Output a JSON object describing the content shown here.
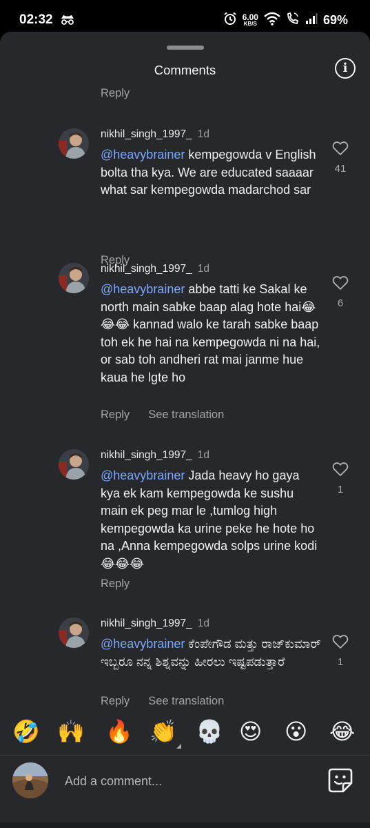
{
  "status_bar": {
    "time": "02:32",
    "net_speed_value": "6.00",
    "net_speed_unit": "KB/S",
    "battery": "69%"
  },
  "sheet": {
    "title": "Comments",
    "info_icon": "info-icon"
  },
  "reply_label_top": "Reply",
  "comments": [
    {
      "username": "nikhil_singh_1997_",
      "time": "1d",
      "mention": "@heavybrainer",
      "text": " kempegowda v English bolta tha kya. We are educated saaaar what sar kempegowda madarchod sar",
      "likes": "41",
      "reply": "Reply",
      "see_translation": ""
    },
    {
      "username": "nikhil_singh_1997_",
      "time": "1d",
      "mention": "@heavybrainer",
      "text": " abbe tatti ke Sakal ke north main sabke baap alag hote hai😂😂😂 kannad walo ke tarah sabke baap toh ek he hai na kempegowda ni na hai, or sab toh andheri rat mai janme hue kaua he lgte ho",
      "likes": "6",
      "reply": "Reply",
      "see_translation": "See translation"
    },
    {
      "username": "nikhil_singh_1997_",
      "time": "1d",
      "mention": "@heavybrainer",
      "text": " Jada heavy ho gaya kya ek kam kempegowda ke sushu main ek peg mar le ,tumlog high kempegowda ka urine peke he hote ho na ,Anna kempegowda solps urine kodi😂😂😂",
      "likes": "1",
      "reply": "Reply",
      "see_translation": ""
    },
    {
      "username": "nikhil_singh_1997_",
      "time": "1d",
      "mention": "@heavybrainer",
      "text": " ಕೆಂಪೇಗೌಡ ಮತ್ತು ರಾಜ್‌ಕುಮಾರ್ ಇಬ್ಬರೂ ನನ್ನ ಶಿಶ್ನವನ್ನು ಹೀರಲು ಇಷ್ಟಪಡುತ್ತಾರೆ",
      "likes": "1",
      "reply": "Reply",
      "see_translation": "See translation"
    }
  ],
  "reactions": [
    "🤣",
    "🙌",
    "🔥",
    "👏",
    "💀",
    "😍",
    "😮",
    "😂"
  ],
  "input": {
    "placeholder": "Add a comment...",
    "value": ""
  },
  "icons": {
    "heart": "heart-outline-icon",
    "sticker": "sticker-icon",
    "incognito": "incognito-icon",
    "wifi": "wifi-icon",
    "call": "wifi-call-icon",
    "alarm": "alarm-icon"
  }
}
